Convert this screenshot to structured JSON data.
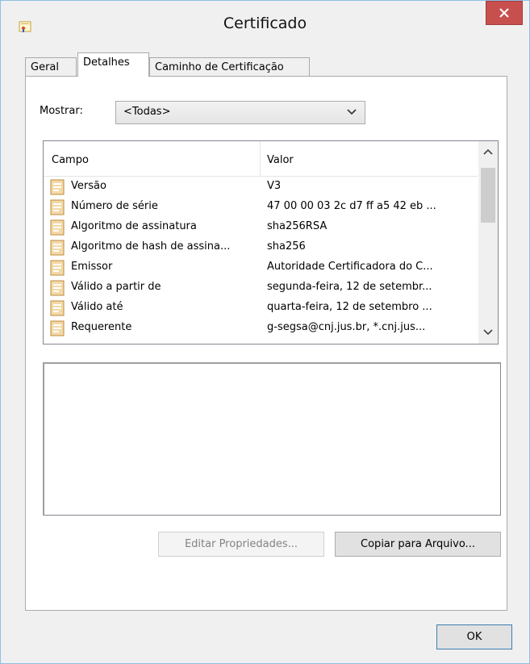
{
  "window": {
    "title": "Certificado"
  },
  "tabs": [
    {
      "label": "Geral",
      "active": false
    },
    {
      "label": "Detalhes",
      "active": true
    },
    {
      "label": "Caminho de Certificação",
      "active": false
    }
  ],
  "filter": {
    "label": "Mostrar:",
    "selected": "<Todas>"
  },
  "fields_list": {
    "columns": [
      "Campo",
      "Valor"
    ],
    "rows": [
      {
        "field": "Versão",
        "value": "V3"
      },
      {
        "field": "Número de série",
        "value": "47 00 00 03 2c d7 ff a5 42 eb ..."
      },
      {
        "field": "Algoritmo de assinatura",
        "value": "sha256RSA"
      },
      {
        "field": "Algoritmo de hash de assina...",
        "value": "sha256"
      },
      {
        "field": "Emissor",
        "value": "Autoridade Certificadora do C..."
      },
      {
        "field": "Válido a partir de",
        "value": "segunda-feira, 12 de setembr..."
      },
      {
        "field": "Válido até",
        "value": "quarta-feira, 12 de setembro ..."
      },
      {
        "field": "Requerente",
        "value": "g-segsa@cnj.jus.br, *.cnj.jus..."
      }
    ]
  },
  "buttons": {
    "edit_properties": "Editar Propriedades...",
    "copy_to_file": "Copiar para Arquivo...",
    "ok": "OK"
  },
  "colors": {
    "close_button": "#c7504f",
    "accent_border": "#8fc0e3"
  },
  "icons": {
    "title": "certificate-icon",
    "close": "close-icon",
    "row": "field-icon",
    "dropdown": "chevron-down-icon"
  }
}
